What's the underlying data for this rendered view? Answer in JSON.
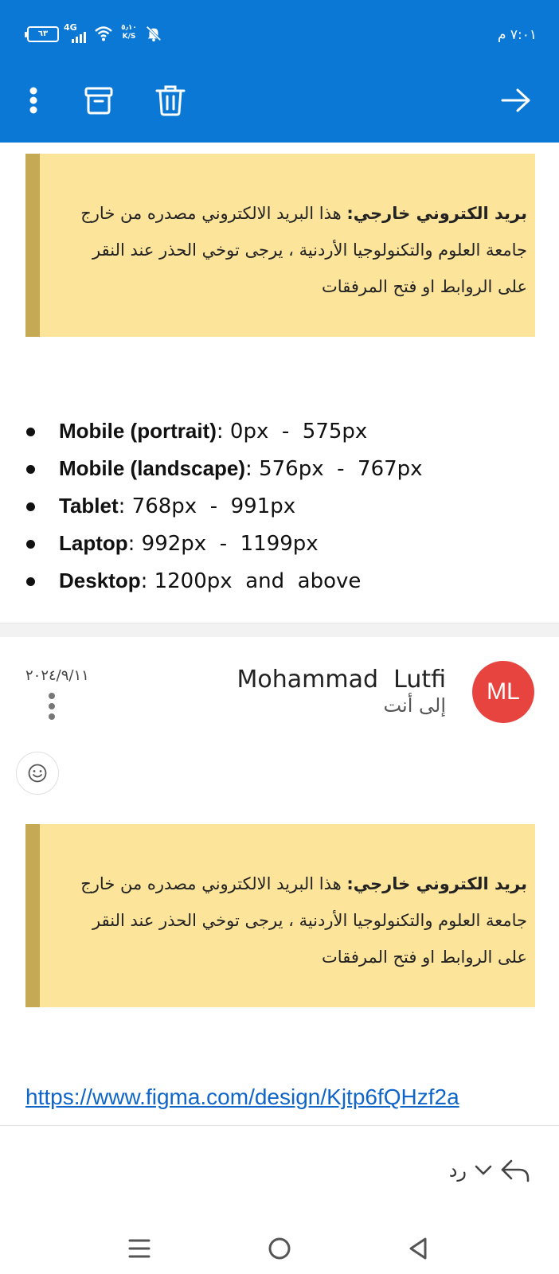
{
  "status_bar": {
    "battery": "٦٣",
    "network": "4G",
    "speed_value": "٥٫١٠",
    "speed_unit": "K/S",
    "time": "٧:٠١ م"
  },
  "toolbar": {
    "icons": [
      "more-vertical-icon",
      "archive-icon",
      "delete-icon",
      "forward-arrow-icon"
    ]
  },
  "messages": [
    {
      "banner": {
        "bold": "بريد الكتروني خارجي:",
        "text": " هذا البريد الالكتروني مصدره من خارج جامعة العلوم والتكنولوجيا الأردنية ، يرجى توخي الحذر عند النقر على الروابط او فتح المرفقات"
      },
      "breakpoints": [
        {
          "name": "Mobile (portrait)",
          "range": ": 0px  -  575px"
        },
        {
          "name": "Mobile (landscape)",
          "range": ": 576px  -  767px"
        },
        {
          "name": "Tablet",
          "range": ": 768px  -  991px"
        },
        {
          "name": "Laptop",
          "range": ": 992px  -  1199px"
        },
        {
          "name": "Desktop",
          "range": ": 1200px  and  above"
        }
      ]
    },
    {
      "sender": "Mohammad  Lutfi",
      "avatar_initials": "ML",
      "avatar_color": "#e74440",
      "recipient": "إلى أنت",
      "date": "٢٠٢٤/٩/١١",
      "banner": {
        "bold": "بريد الكتروني خارجي:",
        "text": " هذا البريد الالكتروني مصدره من خارج جامعة العلوم والتكنولوجيا الأردنية ، يرجى توخي الحذر عند النقر على الروابط او فتح المرفقات"
      },
      "link": "https://www.figma.com/design/Kjtp6fQHzf2a"
    }
  ],
  "reply": {
    "label": "رد"
  },
  "colors": {
    "header": "#0b78d6",
    "banner_bg": "#fce49a",
    "banner_border": "#c5a955",
    "link": "#1066c8"
  }
}
